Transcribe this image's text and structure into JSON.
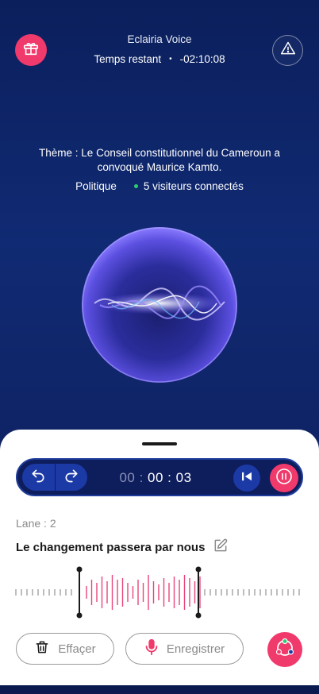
{
  "header": {
    "app_title": "Eclairia Voice",
    "remaining_label": "Temps restant",
    "separator": "•",
    "remaining_value": "-02:10:08",
    "gift_icon": "gift-icon",
    "alert_icon": "warning-triangle-icon"
  },
  "topic": {
    "theme": "Thème : Le Conseil constitutionnel du Cameroun a convoqué Maurice Kamto.",
    "category": "Politique",
    "online": "5 visiteurs connectés"
  },
  "player": {
    "timer_minutes": "00 :",
    "timer_rest": "00 : 03",
    "undo_icon": "undo-icon",
    "redo_icon": "redo-icon",
    "skip_icon": "skip-back-icon",
    "pause_icon": "pause-icon"
  },
  "recording": {
    "lane": "Lane : 2",
    "phrase": "Le changement passera par nous",
    "edit_icon": "edit-icon",
    "delete_label": "Effaçer",
    "record_label": "Enregistrer",
    "team_icon": "team-icon"
  },
  "colors": {
    "accent": "#f03a6b",
    "navy": "#0e1d5c",
    "blue": "#1c3aa6",
    "online_dot": "#2ecc71"
  }
}
